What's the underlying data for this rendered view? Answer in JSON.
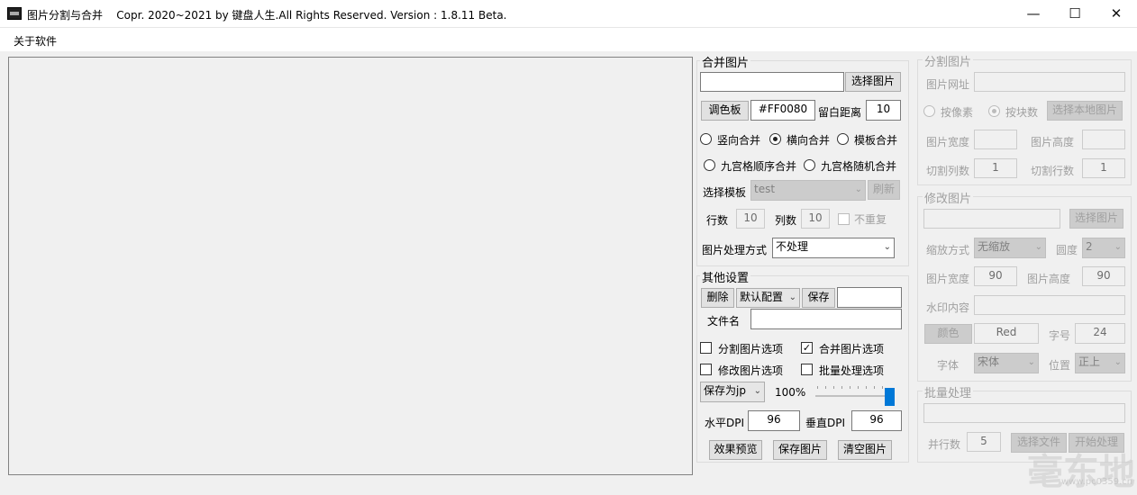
{
  "window": {
    "title": "图片分割与合并",
    "copyright": "Copr. 2020~2021 by 键盘人生.All Rights Reserved.  Version : 1.8.11 Beta.",
    "minimize_glyph": "—",
    "maximize_glyph": "☐",
    "close_glyph": "✕"
  },
  "menu": {
    "about": "关于软件"
  },
  "merge": {
    "title": "合并图片",
    "path_value": "",
    "select_image": "选择图片",
    "palette": "调色板",
    "color_value": "#FF0080",
    "margin_label": "留白距离",
    "margin_value": "10",
    "mode_vertical": "竖向合并",
    "mode_horizontal": "横向合并",
    "mode_template": "模板合并",
    "mode_grid_seq": "九宫格顺序合并",
    "mode_grid_rand": "九宫格随机合并",
    "select_template_label": "选择模板",
    "template_value": "test",
    "refresh": "刷新",
    "rows_label": "行数",
    "rows_value": "10",
    "cols_label": "列数",
    "cols_value": "10",
    "no_repeat": "不重复",
    "process_label": "图片处理方式",
    "process_value": "不处理"
  },
  "other": {
    "title": "其他设置",
    "delete": "删除",
    "config_value": "默认配置",
    "save": "保存",
    "config_name_value": "",
    "filename_label": "文件名",
    "filename_value": "",
    "opt_split": "分割图片选项",
    "opt_merge": "合并图片选项",
    "opt_modify": "修改图片选项",
    "opt_batch": "批量处理选项",
    "merge_checked_mark": "✓",
    "format_value": "保存为jp",
    "quality_value": "100%",
    "quality_level": 1.0,
    "hdpi_label": "水平DPI",
    "hdpi_value": "96",
    "vdpi_label": "垂直DPI",
    "vdpi_value": "96",
    "preview": "效果预览",
    "save_image": "保存图片",
    "clear_image": "清空图片"
  },
  "split": {
    "title": "分割图片",
    "url_label": "图片网址",
    "url_value": "",
    "by_pixel": "按像素",
    "by_block": "按块数",
    "select_local": "选择本地图片",
    "width_label": "图片宽度",
    "width_value": "",
    "height_label": "图片高度",
    "height_value": "",
    "cols_label": "切割列数",
    "cols_value": "1",
    "rows_label": "切割行数",
    "rows_value": "1"
  },
  "modify": {
    "title": "修改图片",
    "path_value": "",
    "select_image": "选择图片",
    "scale_label": "缩放方式",
    "scale_value": "无缩放",
    "round_label": "圆度",
    "round_value": "2",
    "width_label": "图片宽度",
    "width_value": "90",
    "height_label": "图片高度",
    "height_value": "90",
    "watermark_label": "水印内容",
    "watermark_value": "",
    "color_btn": "颜色",
    "color_value": "Red",
    "fontsize_label": "字号",
    "fontsize_value": "24",
    "font_label": "字体",
    "font_value": "宋体",
    "position_label": "位置",
    "position_value": "正上"
  },
  "batch": {
    "title": "批量处理",
    "path_value": "",
    "threads_label": "并行数",
    "threads_value": "5",
    "select_folder": "选择文件",
    "start": "开始处理"
  },
  "watermark": {
    "text": "毫东地",
    "url": "www.pc0359.cn"
  }
}
